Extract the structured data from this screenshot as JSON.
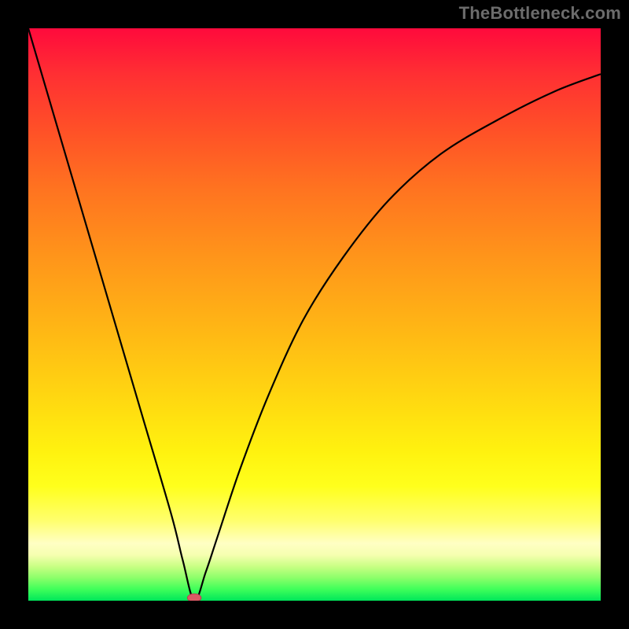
{
  "watermark": "TheBottleneck.com",
  "colors": {
    "frame": "#000000",
    "curve": "#000000",
    "marker_fill": "#da5a65",
    "marker_stroke": "#bd3e4f",
    "gradient_top": "#ff0a3c",
    "gradient_bottom": "#00e65a"
  },
  "chart_data": {
    "type": "line",
    "title": "",
    "xlabel": "",
    "ylabel": "",
    "xlim": [
      0,
      1
    ],
    "ylim": [
      0,
      1
    ],
    "legend": false,
    "grid": false,
    "note": "Axes are unlabeled; x and y run 0–1 across the plot area. Curve values estimated from pixel position; minimum reaches ~0 at x≈0.29.",
    "series": [
      {
        "name": "curve",
        "x": [
          0.0,
          0.05,
          0.1,
          0.15,
          0.2,
          0.25,
          0.27,
          0.29,
          0.31,
          0.33,
          0.37,
          0.42,
          0.48,
          0.55,
          0.63,
          0.72,
          0.82,
          0.92,
          1.0
        ],
        "values": [
          1.0,
          0.83,
          0.66,
          0.49,
          0.32,
          0.15,
          0.07,
          0.0,
          0.05,
          0.11,
          0.23,
          0.36,
          0.49,
          0.6,
          0.7,
          0.78,
          0.84,
          0.89,
          0.92
        ]
      }
    ],
    "marker": {
      "x": 0.29,
      "y": 0.005,
      "rx": 0.012,
      "ry": 0.007
    }
  }
}
